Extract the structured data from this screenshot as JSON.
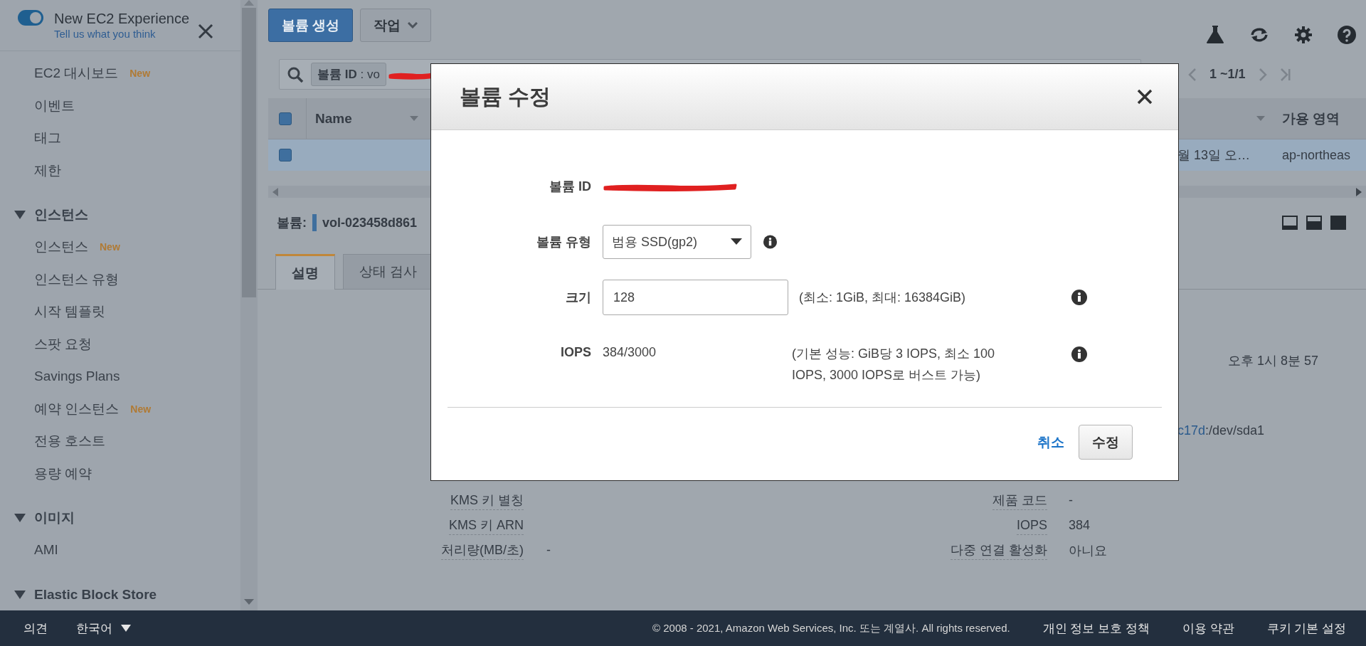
{
  "sidebar": {
    "banner": {
      "toggle_on": true,
      "title": "New EC2 Experience",
      "link": "Tell us what you think"
    },
    "items": [
      {
        "kind": "item",
        "label": "EC2 대시보드",
        "badge": "New"
      },
      {
        "kind": "item",
        "label": "이벤트"
      },
      {
        "kind": "item",
        "label": "태그"
      },
      {
        "kind": "item",
        "label": "제한"
      },
      {
        "kind": "section",
        "label": "인스턴스",
        "expanded": true
      },
      {
        "kind": "item",
        "label": "인스턴스",
        "badge": "New"
      },
      {
        "kind": "item",
        "label": "인스턴스 유형"
      },
      {
        "kind": "item",
        "label": "시작 템플릿"
      },
      {
        "kind": "item",
        "label": "스팟 요청"
      },
      {
        "kind": "item",
        "label": "Savings Plans"
      },
      {
        "kind": "item",
        "label": "예약 인스턴스",
        "badge": "New"
      },
      {
        "kind": "item",
        "label": "전용 호스트"
      },
      {
        "kind": "item",
        "label": "용량 예약"
      },
      {
        "kind": "section",
        "label": "이미지",
        "expanded": true
      },
      {
        "kind": "item",
        "label": "AMI"
      },
      {
        "kind": "section",
        "label": "Elastic Block Store",
        "expanded": true
      }
    ]
  },
  "toolbar": {
    "buttons": [
      {
        "kind": "primary",
        "label": "볼륨 생성"
      },
      {
        "kind": "menu",
        "label": "작업"
      }
    ]
  },
  "search": {
    "filter": "**볼륨 ID** : vo",
    "redacted": true
  },
  "pagination": {
    "range": "1 ~1/1"
  },
  "table": {
    "header_checked": true,
    "columns": [
      {
        "label": "Name",
        "sort_caret": true
      },
      {
        "sort_caret": true
      },
      {
        "label": "가용 영역",
        "sort_caret": false
      }
    ],
    "rows": [
      {
        "selected": true,
        "checked": true,
        "column_2": "월 13일 오…",
        "zone": "ap-northeas"
      }
    ]
  },
  "detail": {
    "label": "볼륨:",
    "volume": "vol-023458d861",
    "tabs": [
      {
        "label": "설명",
        "selected": true
      },
      {
        "label": "상태 검사",
        "selected": false
      }
    ],
    "fragments": [
      {
        "text": "오후 1시 8분 57"
      },
      {
        "link": "c17d",
        "text": ":/dev/sda1"
      }
    ],
    "rows": [
      {
        "left_label": "KMS 키 별칭",
        "right_label": "제품 코드",
        "right_value": "-"
      },
      {
        "left_label": "KMS 키 ARN",
        "right_label": "IOPS",
        "right_value": "384"
      },
      {
        "left_label": "처리량(MB/초)",
        "left_value": "-",
        "right_label": "다중 연결 활성화",
        "right_value": "아니요"
      }
    ]
  },
  "modal": {
    "title": "볼륨 수정",
    "fields": [
      {
        "kind": "redacted",
        "label": "볼륨 ID"
      },
      {
        "kind": "select",
        "label": "볼륨 유형",
        "value": "범용 SSD(gp2)",
        "info": true
      },
      {
        "kind": "input",
        "label": "크기",
        "value": "128",
        "hint": "(최소: 1GiB, 최대: 16384GiB)",
        "info": true
      },
      {
        "kind": "static",
        "label": "IOPS",
        "value": "384/3000",
        "hint": "(기본 성능: GiB당 3 IOPS, 최소 100 IOPS, 3000 IOPS로 버스트 가능)",
        "info": true
      }
    ],
    "cancel": "취소",
    "submit": "수정"
  },
  "footer": {
    "feedback": "의견",
    "language": "한국어",
    "copyright": "© 2008 - 2021, Amazon Web Services, Inc. 또는 계열사. All rights reserved.",
    "links": [
      "개인 정보 보호 정책",
      "이용 약관",
      "쿠키 기본 설정"
    ]
  }
}
